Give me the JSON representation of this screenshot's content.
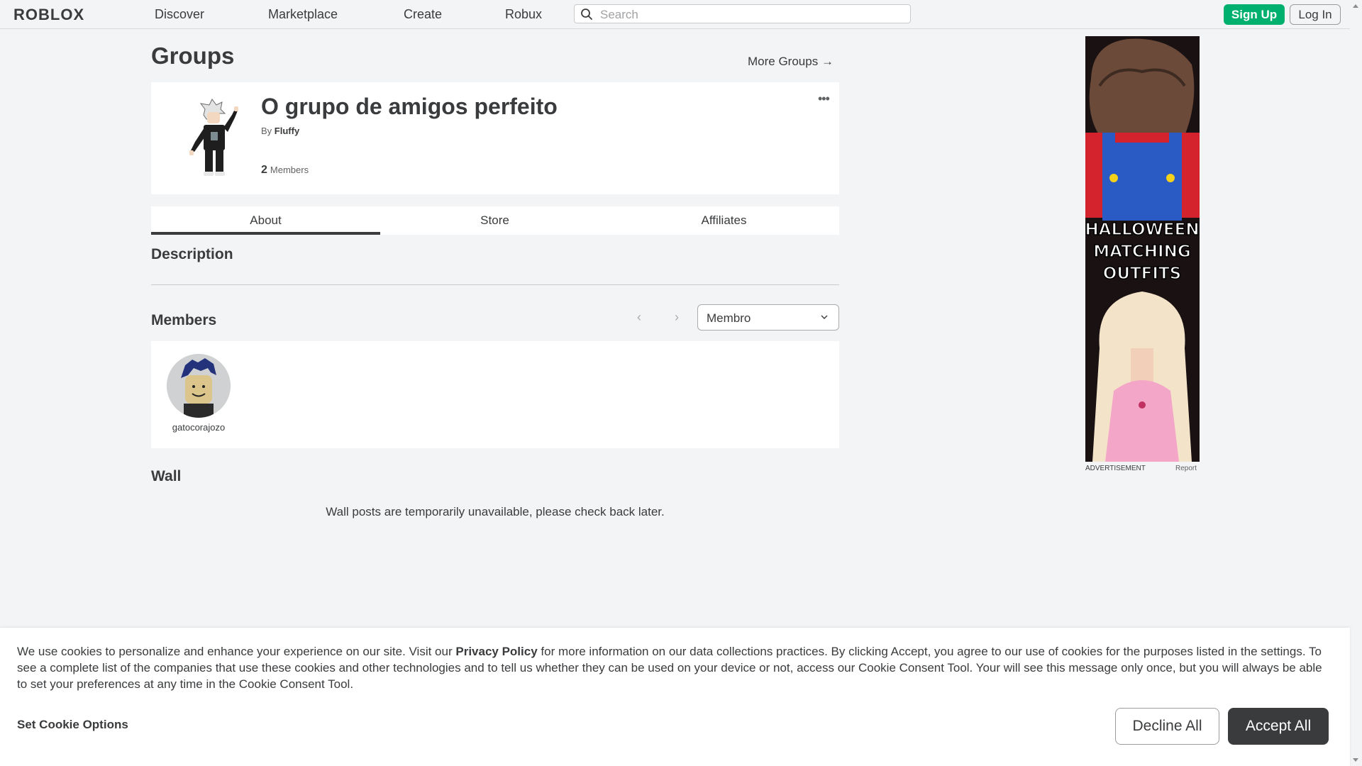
{
  "nav": {
    "logo": "ROBLOX",
    "links": [
      "Discover",
      "Marketplace",
      "Create",
      "Robux"
    ],
    "search_placeholder": "Search",
    "signup": "Sign Up",
    "login": "Log In"
  },
  "page": {
    "title": "Groups",
    "more_groups": "More Groups"
  },
  "group": {
    "name": "O grupo de amigos perfeito",
    "by_label": "By",
    "owner": "Fluffy",
    "member_count": "2",
    "members_label": "Members"
  },
  "tabs": [
    "About",
    "Store",
    "Affiliates"
  ],
  "sections": {
    "description": "Description",
    "members": "Members",
    "wall": "Wall"
  },
  "members": {
    "role_selected": "Membro",
    "list": [
      {
        "name": "gatocorajozo"
      }
    ]
  },
  "wall": {
    "message": "Wall posts are temporarily unavailable, please check back later."
  },
  "ad": {
    "lines": [
      "HALLOWEEN",
      "MATCHING",
      "OUTFITS"
    ],
    "label": "ADVERTISEMENT",
    "report": "Report"
  },
  "cookie": {
    "text_before": "We use cookies to personalize and enhance your experience on our site. Visit our ",
    "privacy_link": "Privacy Policy",
    "text_after": " for more information on our data collections practices. By clicking Accept, you agree to our use of cookies for the purposes listed in the settings. To see a complete list of the companies that use these cookies and other technologies and to tell us whether they can be used on your device or not, access our Cookie Consent Tool. Your will see this message only once, but you will always be able to set your preferences at any time in the Cookie Consent Tool.",
    "options": "Set Cookie Options",
    "decline": "Decline All",
    "accept": "Accept All"
  },
  "colors": {
    "accent_green": "#00b06f",
    "text": "#393b3d",
    "background": "#f2f4f5"
  }
}
